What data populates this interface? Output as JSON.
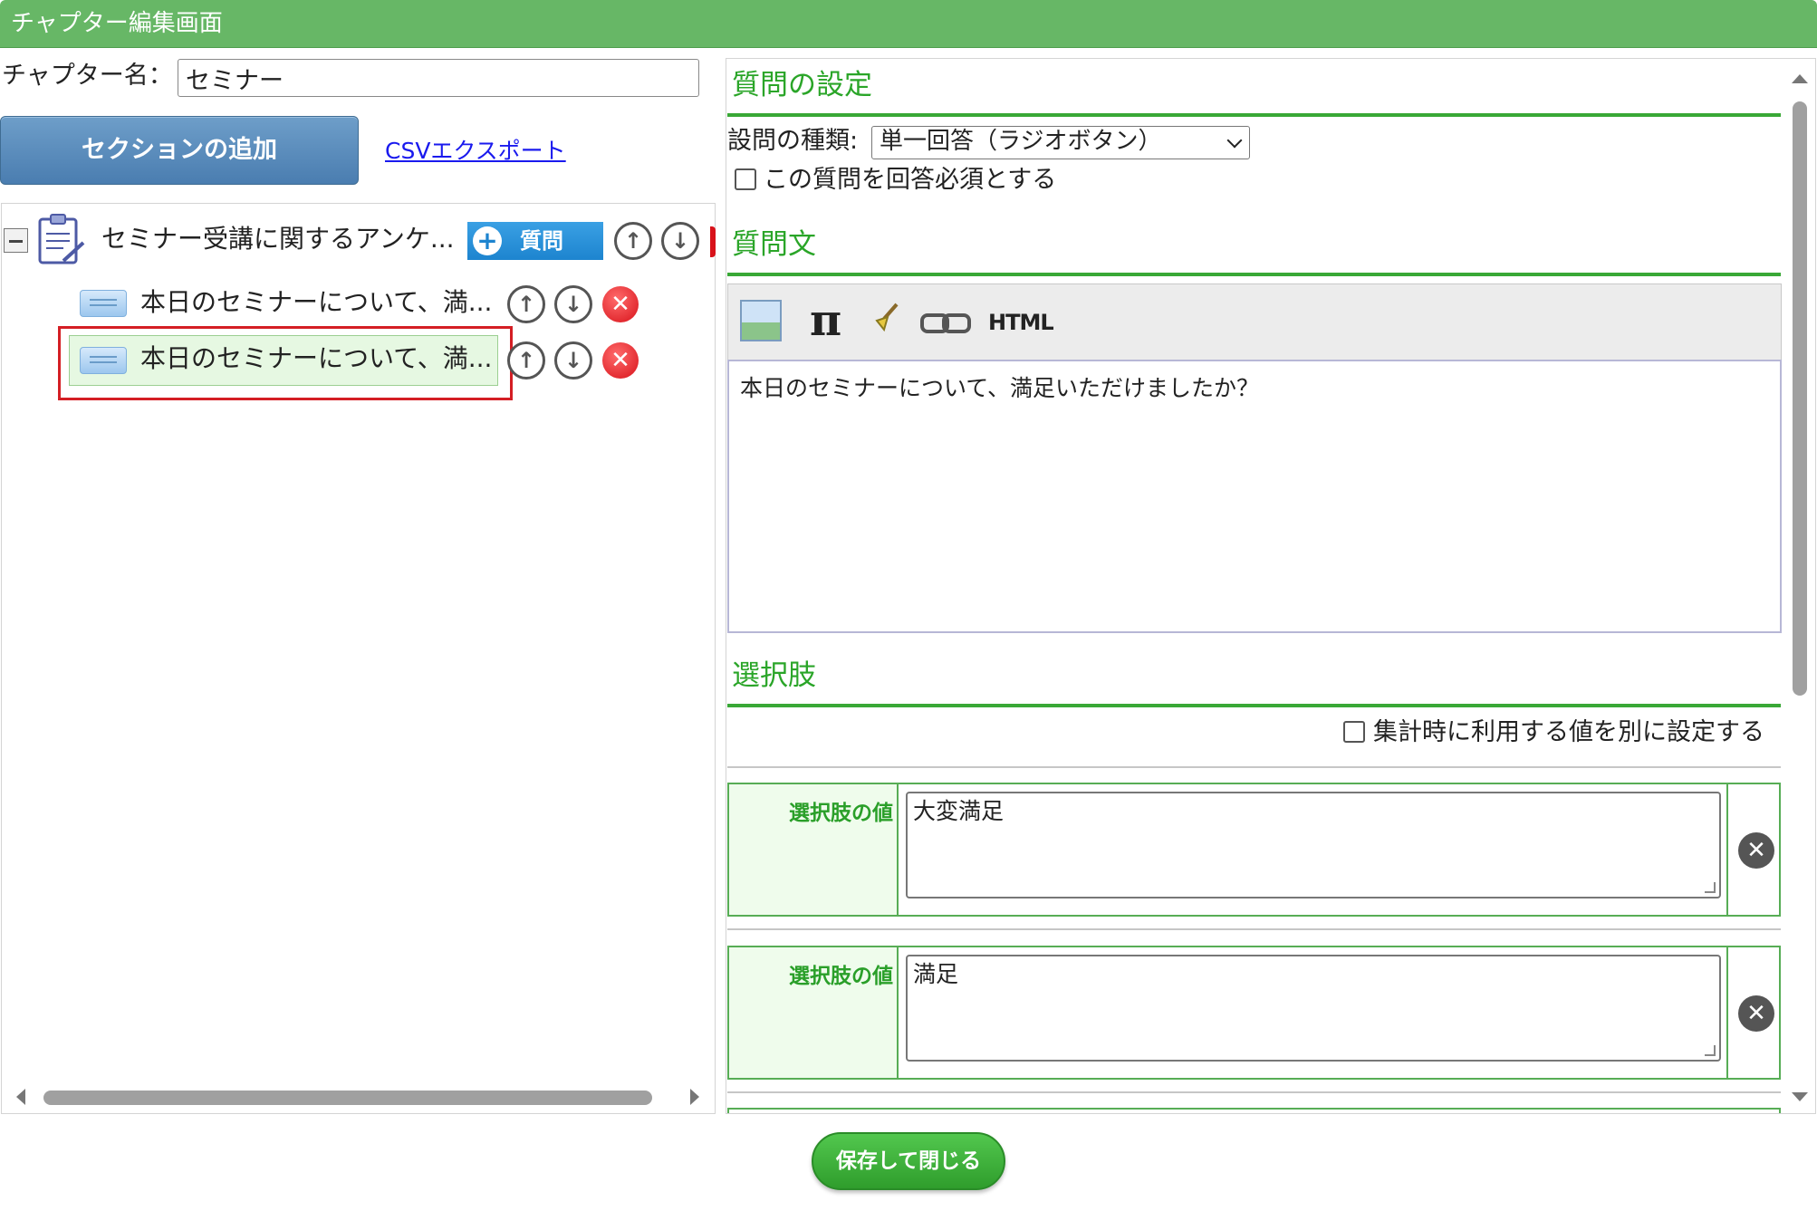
{
  "window": {
    "title": "チャプター編集画面"
  },
  "chapter": {
    "name_label": "チャプター名：",
    "name_value": "セミナー"
  },
  "toolbar": {
    "add_section_label": "セクションの追加",
    "csv_export_label": "CSVエクスポート"
  },
  "tree": {
    "root": {
      "label": "セミナー受講に関するアンケ...",
      "add_question_label": "質問"
    },
    "items": [
      {
        "label": "本日のセミナーについて、満..."
      },
      {
        "label": "本日のセミナーについて、満...",
        "selected": true
      }
    ]
  },
  "question_settings": {
    "section_title": "質問の設定",
    "type_label": "設問の種類:",
    "type_value": "単一回答（ラジオボタン）",
    "required_label": "この質問を回答必須とする",
    "required_checked": false
  },
  "question_text": {
    "section_title": "質問文",
    "editor_tools": [
      "image-icon",
      "pi-icon",
      "brush-icon",
      "link-icon",
      "html-icon"
    ],
    "html_tool_label": "HTML",
    "pi_glyph": "π",
    "value": "本日のセミナーについて、満足いただけましたか？"
  },
  "choices": {
    "section_title": "選択肢",
    "aggregate_label": "集計時に利用する値を別に設定する",
    "aggregate_checked": false,
    "items": [
      {
        "label": "選択肢の値",
        "value": "大変満足"
      },
      {
        "label": "選択肢の値",
        "value": "満足"
      }
    ]
  },
  "footer": {
    "save_label": "保存して閉じる"
  },
  "colors": {
    "title_bar": "#67b766",
    "section_green": "#2aa528",
    "selected_bg": "#e6f8e2",
    "highlight_red": "#d41e24"
  }
}
